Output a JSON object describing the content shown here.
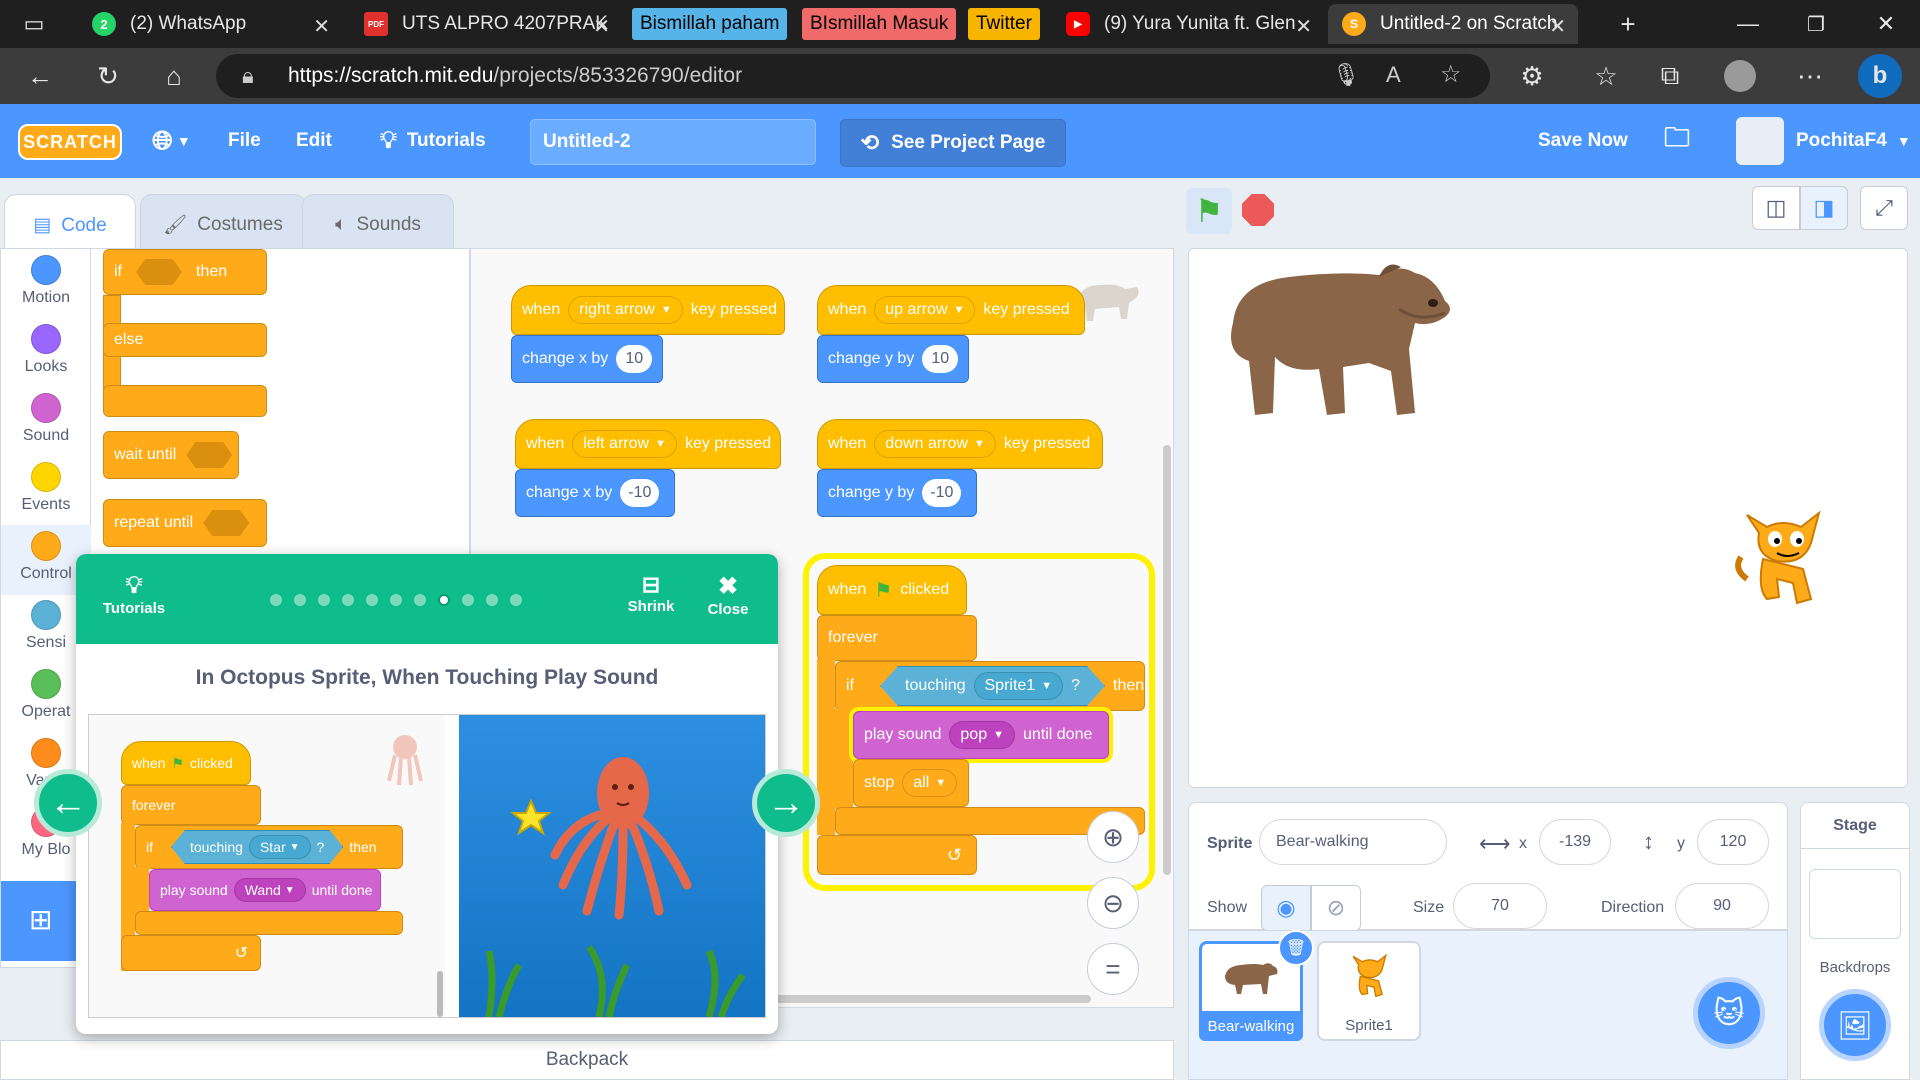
{
  "browser": {
    "tabs": [
      {
        "label": "",
        "icon": "window-icon"
      },
      {
        "label": "(2) WhatsApp",
        "icon": "whatsapp-icon",
        "badge": "2"
      },
      {
        "label": "UTS ALPRO 4207PRAK",
        "icon": "pdf-icon",
        "badge": "PDF"
      },
      {
        "label": "Untitled-2 on Scratch",
        "icon": "scratch-icon"
      }
    ],
    "bookmarks": [
      {
        "label": "Bismillah paham",
        "color": "#56b4e9"
      },
      {
        "label": "BIsmillah Masuk",
        "color": "#f06a6a"
      },
      {
        "label": "Twitter",
        "color": "#f7b500"
      }
    ],
    "yt_tab": "(9) Yura Yunita ft. Glen",
    "url_host": "https://scratch.mit.edu",
    "url_path": "/projects/853326790/editor"
  },
  "menu": {
    "logo": "SCRATCH",
    "file": "File",
    "edit": "Edit",
    "tutorials": "Tutorials",
    "project_title": "Untitled-2",
    "see_project": "See Project Page",
    "save_now": "Save Now",
    "username": "PochitaF4"
  },
  "editor_tabs": {
    "code": "Code",
    "costumes": "Costumes",
    "sounds": "Sounds"
  },
  "categories": [
    {
      "label": "Motion",
      "color": "#4c97ff"
    },
    {
      "label": "Looks",
      "color": "#9966ff"
    },
    {
      "label": "Sound",
      "color": "#cf63cf"
    },
    {
      "label": "Events",
      "color": "#ffd500"
    },
    {
      "label": "Control",
      "color": "#ffab19"
    },
    {
      "label": "Sensi",
      "color": "#5cb1d6"
    },
    {
      "label": "Operat",
      "color": "#59c059"
    },
    {
      "label": "Varial",
      "color": "#ff8c1a"
    },
    {
      "label": "My Blo",
      "color": "#ff6680"
    }
  ],
  "palette_blocks": {
    "if": "if",
    "then": "then",
    "else": "else",
    "wait_until": "wait until",
    "repeat_until": "repeat until"
  },
  "scripts": {
    "when": "when",
    "key_pressed": "key pressed",
    "change_x": "change x by",
    "change_y": "change y by",
    "right": "right arrow",
    "up": "up arrow",
    "left": "left arrow",
    "down": "down arrow",
    "v10": "10",
    "vneg10": "-10",
    "clicked": "clicked",
    "forever": "forever",
    "if": "if",
    "touching": "touching",
    "sprite1": "Sprite1",
    "q": "?",
    "then": "then",
    "play_sound": "play sound",
    "pop": "pop",
    "until_done": "until done",
    "stop": "stop",
    "all": "all"
  },
  "tutorial": {
    "header": "Tutorials",
    "shrink": "Shrink",
    "close": "Close",
    "title": "In Octopus Sprite, When Touching Play Sound",
    "steps_total": 11,
    "current_step": 8,
    "demo": {
      "when": "when",
      "clicked": "clicked",
      "forever": "forever",
      "if": "if",
      "touching": "touching",
      "star": "Star",
      "q": "?",
      "then": "then",
      "play_sound": "play sound",
      "wand": "Wand",
      "until_done": "until done"
    }
  },
  "sprite_info": {
    "sprite_label": "Sprite",
    "sprite_name": "Bear-walking",
    "x_label": "x",
    "x": "-139",
    "y_label": "y",
    "y": "120",
    "show_label": "Show",
    "size_label": "Size",
    "size": "70",
    "direction_label": "Direction",
    "direction": "90"
  },
  "sprites": [
    {
      "name": "Bear-walking",
      "selected": true
    },
    {
      "name": "Sprite1",
      "selected": false
    }
  ],
  "stage_pane": {
    "title": "Stage",
    "backdrops": "Backdrops"
  },
  "backpack": "Backpack"
}
